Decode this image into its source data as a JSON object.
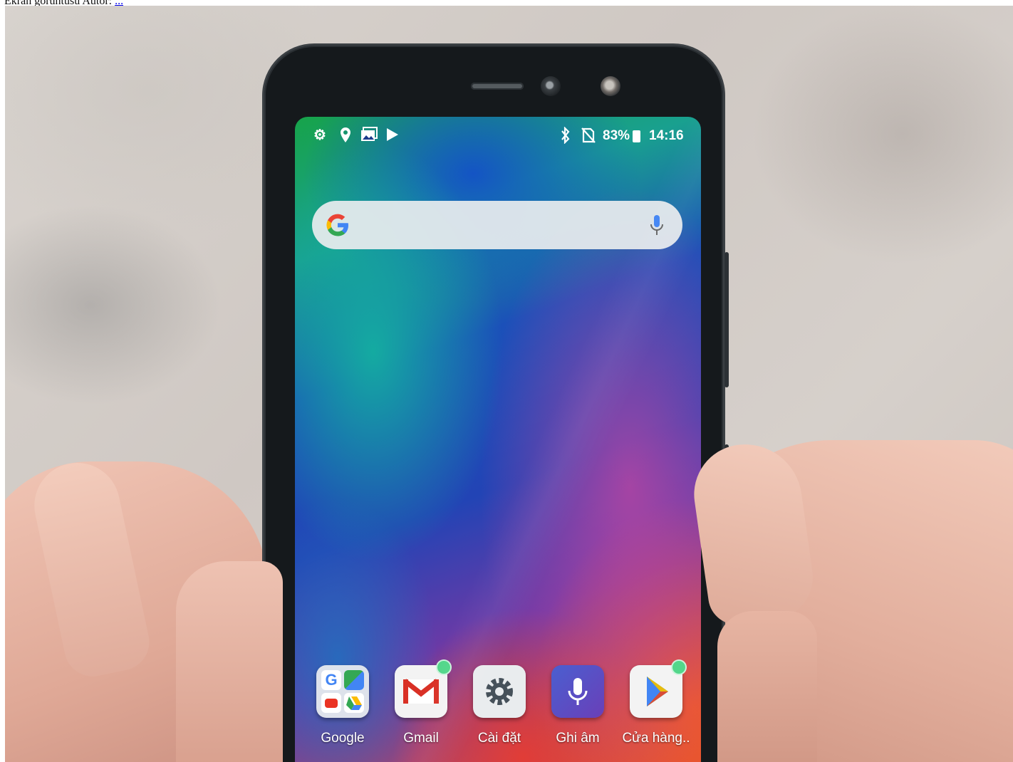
{
  "caption": {
    "prefix": "Ekran görüntüsü",
    "author_label": "Autor:",
    "author_link": "..."
  },
  "status_bar": {
    "icons_left": [
      "settings-icon",
      "location-icon",
      "gallery-icon",
      "play-icon"
    ],
    "icons_right": [
      "bluetooth-icon",
      "no-sim-icon",
      "battery-icon"
    ],
    "battery": "83%",
    "time": "14:16"
  },
  "search_bar": {
    "logo": "google-g-logo",
    "icon_right": "mic-icon"
  },
  "dock": {
    "apps": [
      {
        "label": "Google",
        "icon": "google-folder-icon",
        "badge": false
      },
      {
        "label": "Gmail",
        "icon": "gmail-icon",
        "badge": true
      },
      {
        "label": "Cài đặt",
        "icon": "settings-gear-icon",
        "badge": false
      },
      {
        "label": "Ghi âm",
        "icon": "voice-recorder-icon",
        "badge": false
      },
      {
        "label": "Cửa hàng..",
        "icon": "play-store-icon",
        "badge": true
      }
    ]
  },
  "colors": {
    "badge": "#52d68a",
    "phone_body": "#15191c",
    "background": "#d3cdc8",
    "skin": "#e8b8a8"
  }
}
